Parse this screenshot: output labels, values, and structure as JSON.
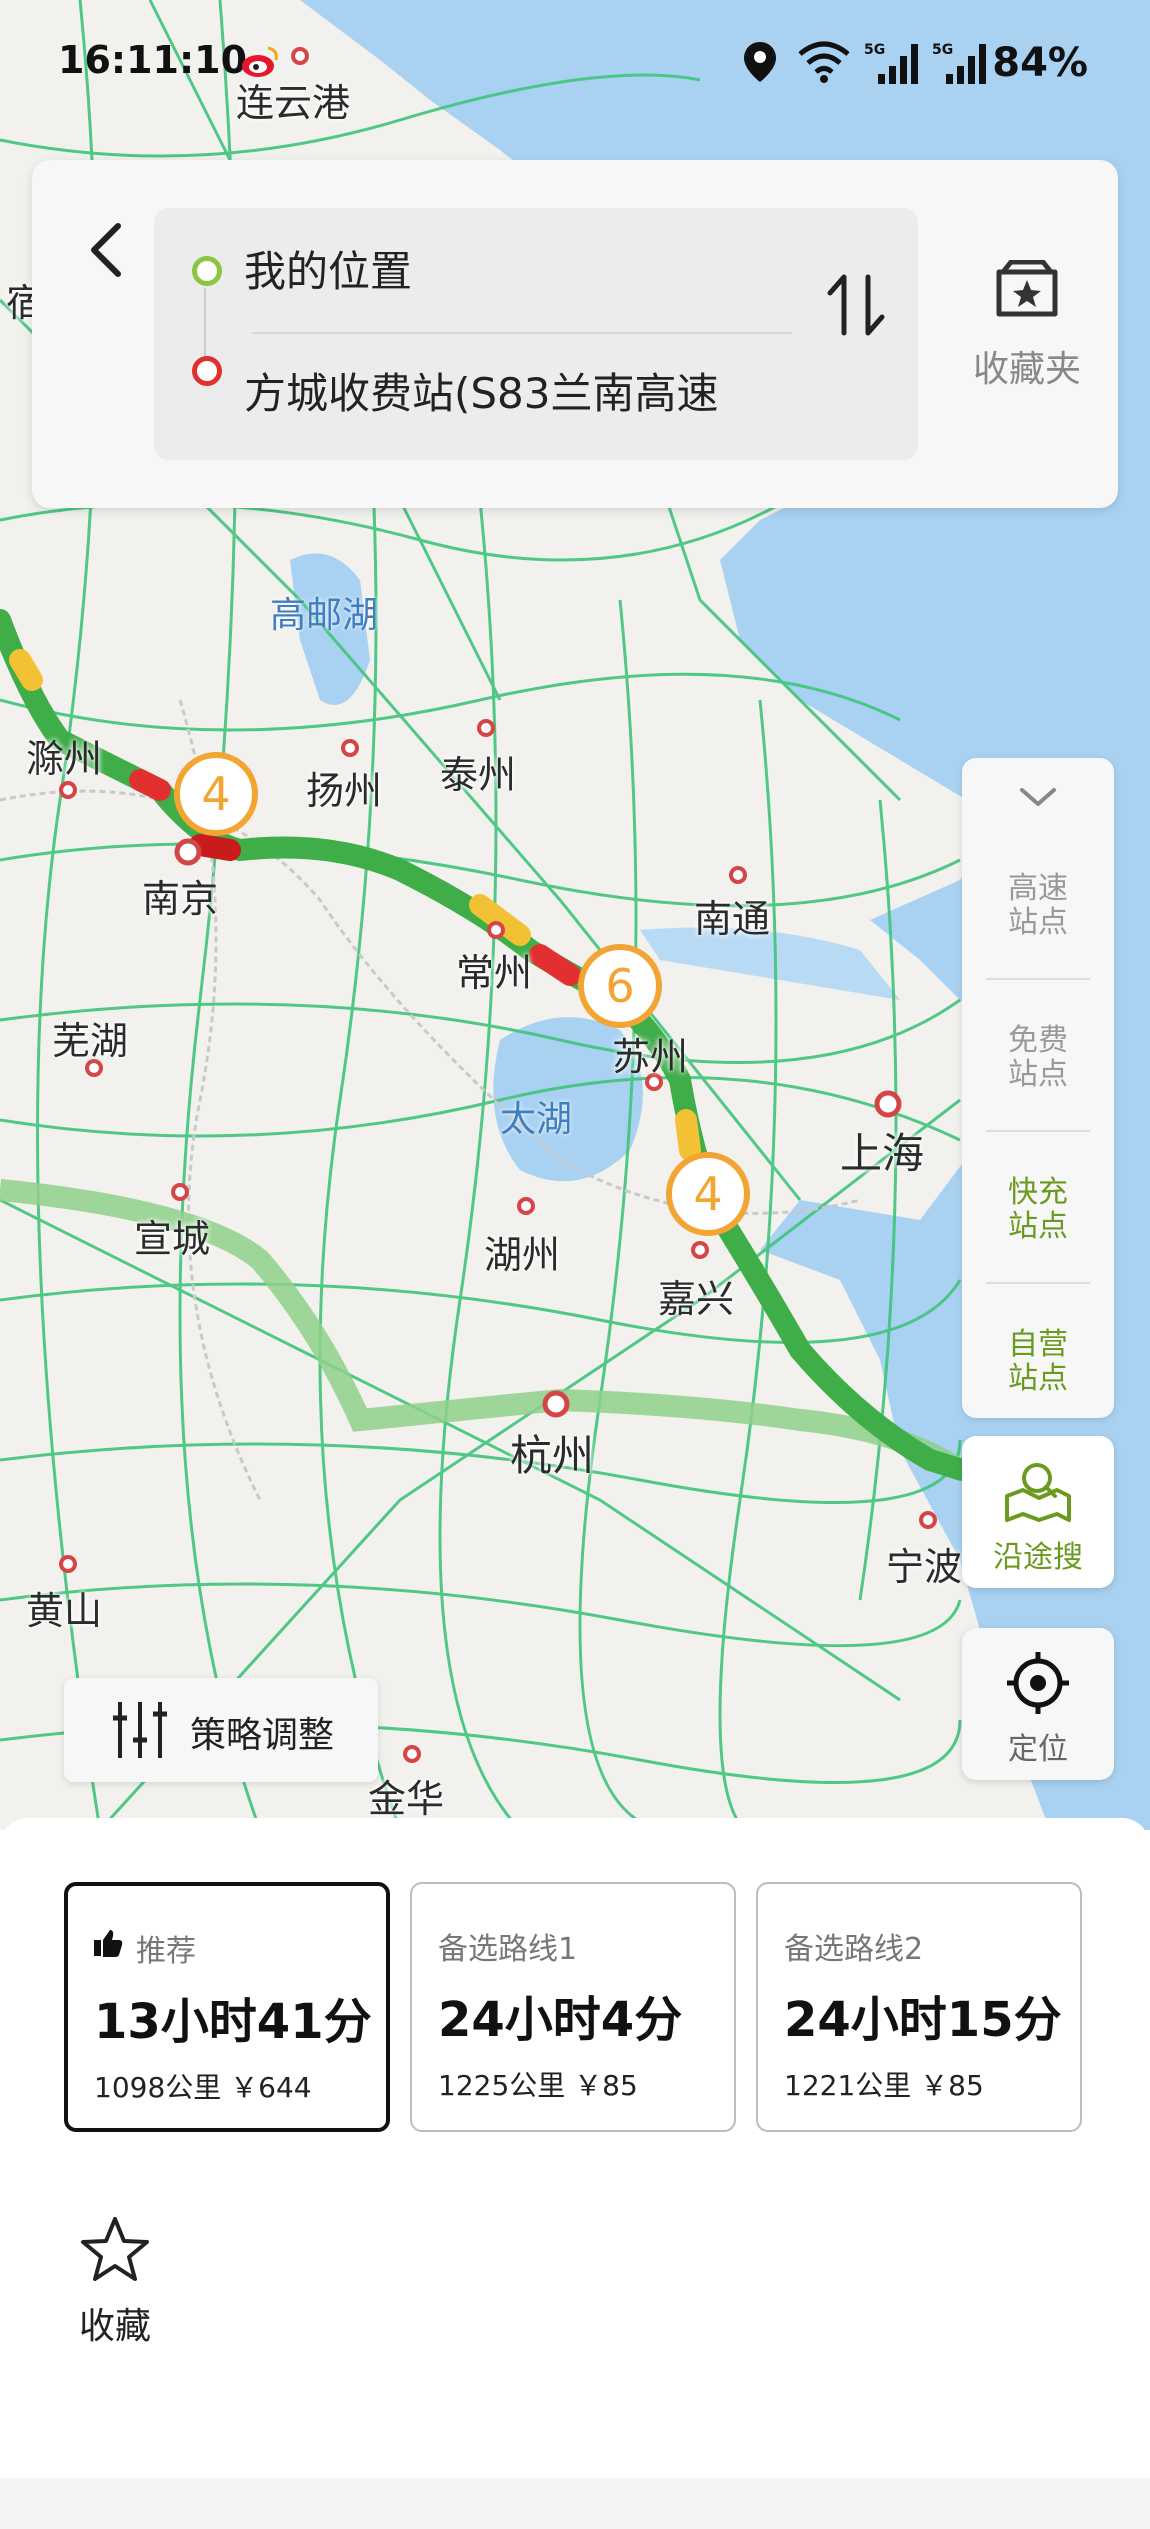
{
  "status_bar": {
    "time": "16:11:10",
    "battery": "84%"
  },
  "search": {
    "origin": "我的位置",
    "destination": "方城收费站(S83兰南高速",
    "favorites_folder_label": "收藏夹"
  },
  "map": {
    "cities": [
      {
        "name": "连云港"
      },
      {
        "name": "宿"
      },
      {
        "name": "滁州"
      },
      {
        "name": "扬州"
      },
      {
        "name": "泰州"
      },
      {
        "name": "南京"
      },
      {
        "name": "南通"
      },
      {
        "name": "常州"
      },
      {
        "name": "芜湖"
      },
      {
        "name": "苏州"
      },
      {
        "name": "上海"
      },
      {
        "name": "宣城"
      },
      {
        "name": "湖州"
      },
      {
        "name": "嘉兴"
      },
      {
        "name": "杭州"
      },
      {
        "name": "宁波"
      },
      {
        "name": "黄山"
      },
      {
        "name": "金华"
      }
    ],
    "lakes": [
      {
        "name": "高邮湖"
      },
      {
        "name": "太湖"
      }
    ],
    "badges": [
      "4",
      "6",
      "4"
    ],
    "route_color": "#3fae49",
    "alt_route_color": "#8fd08a"
  },
  "side_panel": {
    "items": [
      "高速站点",
      "免费站点",
      "快充站点",
      "自营站点"
    ],
    "along_search": "沿途搜",
    "locate": "定位"
  },
  "strategy_label": "策略调整",
  "routes": [
    {
      "label": "推荐",
      "time": "13小时41分",
      "info": "1098公里 ￥644",
      "selected": true
    },
    {
      "label": "备选路线1",
      "time": "24小时4分",
      "info": "1225公里 ￥85",
      "selected": false
    },
    {
      "label": "备选路线2",
      "time": "24小时15分",
      "info": "1221公里 ￥85",
      "selected": false
    }
  ],
  "favorite_label": "收藏"
}
